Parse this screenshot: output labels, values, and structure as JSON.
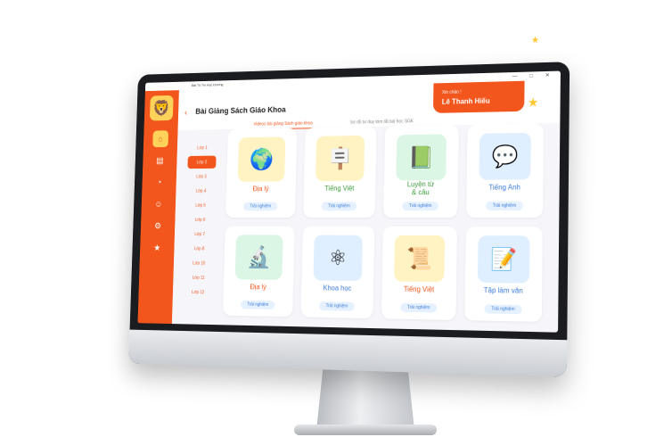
{
  "window": {
    "title": "Bài Tô Tín Học Dường"
  },
  "header": {
    "title": "Bài Giảng Sách Giáo Khoa",
    "tabs": [
      {
        "label": "Videos bài giảng Sách giáo khoa",
        "active": true
      },
      {
        "label": "Sơ đồ tư duy tóm tắt bài học SGK",
        "active": false
      }
    ]
  },
  "greeting": {
    "salutation": "Xin chào !",
    "name": "Lê Thanh Hiếu"
  },
  "grades": [
    "Lớp 1",
    "Lớp 2",
    "Lớp 3",
    "Lớp 4",
    "Lớp 5",
    "Lớp 6",
    "Lớp 7",
    "Lớp 8",
    "Lớp 10",
    "Lớp 11",
    "Lớp 12"
  ],
  "selected_grade": "Lớp 2",
  "subjects": [
    {
      "name": "Địa lý",
      "color": "#f2561d",
      "icon": "globe-icon",
      "glyph": "🌍",
      "bg": "#fff3c4"
    },
    {
      "name": "Tiếng Việt",
      "color": "#3c9b3c",
      "icon": "easel-icon",
      "glyph": "🪧",
      "bg": "#fff3c4"
    },
    {
      "name": "Luyện từ\n& câu",
      "color": "#3c9b3c",
      "icon": "book-abc-icon",
      "glyph": "📗",
      "bg": "#dcf6e6"
    },
    {
      "name": "Tiếng Anh",
      "color": "#3b7bd9",
      "icon": "eng-bubble-icon",
      "glyph": "💬",
      "bg": "#e0efff"
    },
    {
      "name": "Địa lý",
      "color": "#f2561d",
      "icon": "microscope-icon",
      "glyph": "🔬",
      "bg": "#dcf6e6"
    },
    {
      "name": "Khoa học",
      "color": "#3b7bd9",
      "icon": "atom-icon",
      "glyph": "⚛",
      "bg": "#e0efff"
    },
    {
      "name": "Tiếng Việt",
      "color": "#f2561d",
      "icon": "scroll-icon",
      "glyph": "📜",
      "bg": "#fff3c4"
    },
    {
      "name": "Tập làm văn",
      "color": "#3b7bd9",
      "icon": "notebook-pen-icon",
      "glyph": "📝",
      "bg": "#e0efff"
    }
  ],
  "try_label": "Trải nghiệm",
  "nav": [
    {
      "name": "home-icon",
      "glyph": "⌂",
      "active": true
    },
    {
      "name": "book-icon",
      "glyph": "▤",
      "active": false
    },
    {
      "name": "bell-icon",
      "glyph": "◔",
      "active": false
    },
    {
      "name": "user-icon",
      "glyph": "☺",
      "active": false
    },
    {
      "name": "settings-icon",
      "glyph": "⚙",
      "active": false
    },
    {
      "name": "vietnam-flag-icon",
      "glyph": "★",
      "active": false
    }
  ],
  "colors": {
    "primary": "#f2561d",
    "accent": "#ffd25a",
    "link": "#3b7bd9"
  }
}
